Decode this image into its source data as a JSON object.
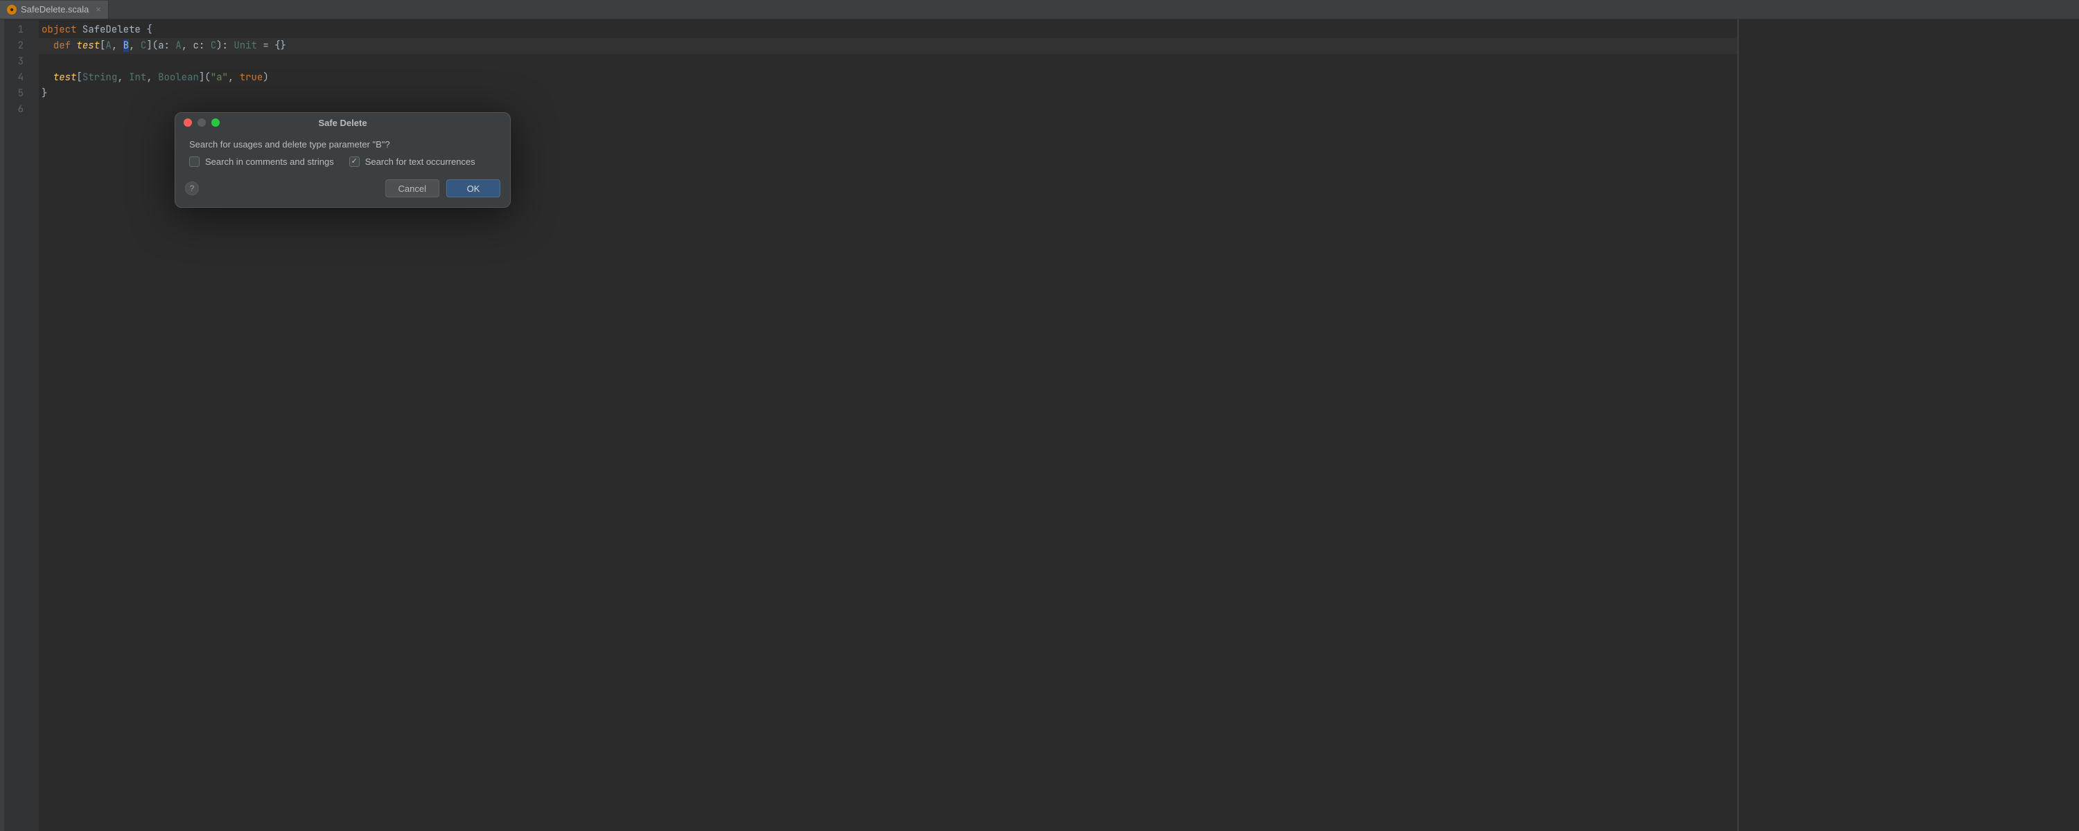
{
  "tab": {
    "filename": "SafeDelete.scala",
    "close_glyph": "×"
  },
  "gutter": {
    "lines": [
      "1",
      "2",
      "3",
      "4",
      "5",
      "6"
    ]
  },
  "code": {
    "l1": {
      "kw": "object",
      "name": " SafeDelete ",
      "brace": "{"
    },
    "l2": {
      "indent": "  ",
      "kw": "def",
      "fn": " test",
      "lb": "[",
      "A": "A",
      "c1": ", ",
      "B": "B",
      "c2": ", ",
      "C": "C",
      "rb": "]",
      "params_open": "(",
      "pa": "a: ",
      "pat": "A",
      "pc1": ", ",
      "pc": "c: ",
      "pct": "C",
      "params_close": ")",
      "ret": ": ",
      "rett": "Unit",
      "eq": " = {}"
    },
    "l4": {
      "indent": "  ",
      "call": "test",
      "lb": "[",
      "t1": "String",
      "c1": ", ",
      "t2": "Int",
      "c2": ", ",
      "t3": "Boolean",
      "rb": "]",
      "po": "(",
      "s": "\"a\"",
      "c3": ", ",
      "true": "true",
      "pc": ")"
    },
    "l5": {
      "brace": "}"
    }
  },
  "dialog": {
    "title": "Safe Delete",
    "message": "Search for usages and delete type parameter \"B\"?",
    "chk1_label": "Search in comments and strings",
    "chk1_checked": false,
    "chk2_label": "Search for text occurrences",
    "chk2_checked": true,
    "help_glyph": "?",
    "cancel_label": "Cancel",
    "ok_label": "OK"
  }
}
